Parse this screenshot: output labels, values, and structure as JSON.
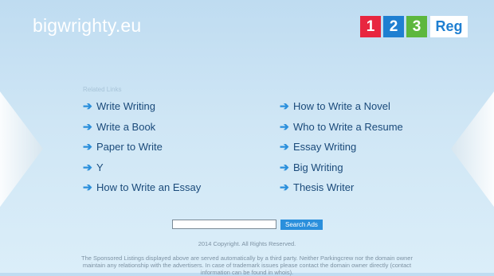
{
  "header": {
    "domain": "bigwrighty.eu",
    "logo": {
      "d1": "1",
      "d2": "2",
      "d3": "3",
      "reg": "Reg"
    }
  },
  "related": {
    "title": "Related Links",
    "left": [
      "Write Writing",
      "Write a Book",
      "Paper to Write",
      "Y",
      "How to Write an Essay"
    ],
    "right": [
      "How to Write a Novel",
      "Who to Write a Resume",
      "Essay Writing",
      "Big Writing",
      "Thesis Writer"
    ]
  },
  "search": {
    "value": "",
    "button_label": "Search Ads"
  },
  "footer": {
    "copyright": "2014 Copyright. All Rights Reserved.",
    "disclaimer": "The Sponsored Listings displayed above are served automatically by a third party. Neither Parkingcrew nor the domain owner maintain any relationship with the advertisers. In case of trademark issues please contact the domain owner directly (contact information can be found in whois)."
  },
  "colors": {
    "link": "#1a4a7a",
    "arrow": "#2a8fdc",
    "logo_red": "#e8263f",
    "logo_blue": "#1f7fd1",
    "logo_green": "#5db73e"
  }
}
